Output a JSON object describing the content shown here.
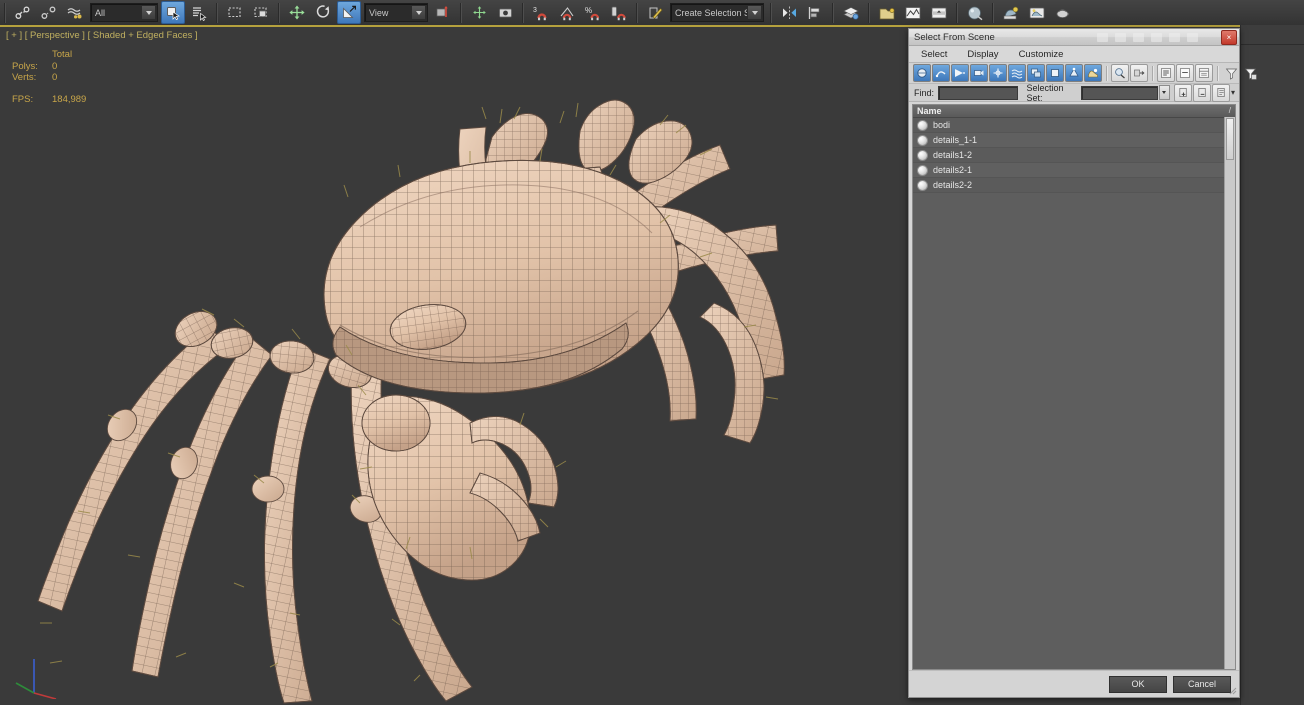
{
  "toolbar": {
    "undo_icon": "undo-icon",
    "redo_icon": "redo-icon",
    "link_icon": "select-and-link-icon",
    "unlink_icon": "unlink-selection-icon",
    "bind_icon": "bind-to-space-warp-icon",
    "selection_filter": "All",
    "select_object_icon": "select-object-icon",
    "select_by_name_icon": "select-by-name-icon",
    "rect_select_icon": "rectangular-selection-region-icon",
    "window_crossing_icon": "window-crossing-icon",
    "move_icon": "select-and-move-icon",
    "rotate_icon": "select-and-rotate-icon",
    "scale_icon": "select-and-uniform-scale-icon",
    "reference_coord_system": "View",
    "pivot_icon": "use-pivot-point-center-icon",
    "snap_icon": "snaps-toggle-icon",
    "snap_label": "3",
    "angle_snap_icon": "angle-snap-toggle-icon",
    "percent_snap_icon": "percent-snap-toggle-icon",
    "percent_label": "%",
    "spinner_snap_icon": "spinner-snap-toggle-icon",
    "edit_named_sets_icon": "edit-named-selection-sets-icon",
    "named_selection_set": "Create Selection Se",
    "mirror_icon": "mirror-icon",
    "align_icon": "align-icon",
    "layer_manager_icon": "layer-manager-icon",
    "curve_editor_icon": "curve-editor-icon",
    "schematic_view_icon": "schematic-view-icon",
    "material_editor_icon": "material-editor-icon",
    "render_setup_icon": "render-setup-icon",
    "rendered_frame_icon": "rendered-frame-window-icon",
    "render_production_icon": "render-production-icon"
  },
  "viewport": {
    "label": "[ + ] [ Perspective ] [ Shaded + Edged Faces ]",
    "stats": {
      "total_header": "Total",
      "polys_label": "Polys:",
      "polys_value": "0",
      "verts_label": "Verts:",
      "verts_value": "0",
      "fps_label": "FPS:",
      "fps_value": "184,989"
    },
    "axis_gizmo": "world-axis-tripod-icon",
    "model": "crab-wireframe-model",
    "background_color": "#3a3a3a",
    "model_color": "#e3c5ab",
    "wire_color": "#5d4a3f"
  },
  "dialog": {
    "title": "Select From Scene",
    "close_label": "×",
    "menu": [
      {
        "label": "Select"
      },
      {
        "label": "Display"
      },
      {
        "label": "Customize"
      }
    ],
    "tools": [
      {
        "name": "display-geometry-icon",
        "state": "on"
      },
      {
        "name": "display-shapes-icon",
        "state": "on"
      },
      {
        "name": "display-lights-icon",
        "state": "on"
      },
      {
        "name": "display-cameras-icon",
        "state": "on"
      },
      {
        "name": "display-helpers-icon",
        "state": "on"
      },
      {
        "name": "display-space-warps-icon",
        "state": "on"
      },
      {
        "name": "display-groups-icon",
        "state": "on"
      },
      {
        "name": "display-xrefs-icon",
        "state": "on"
      },
      {
        "name": "display-bones-icon",
        "state": "on"
      },
      {
        "name": "display-all-icon",
        "state": "on"
      },
      {
        "name": "select-subtree-icon",
        "state": "plain"
      },
      {
        "name": "select-influences-icon",
        "state": "plain"
      },
      {
        "name": "expand-all-icon",
        "state": "plain"
      },
      {
        "name": "collapse-all-icon",
        "state": "plain"
      },
      {
        "name": "list-types-icon",
        "state": "plain"
      },
      {
        "name": "filter-icon",
        "state": "flat"
      },
      {
        "name": "clear-filter-icon",
        "state": "flat"
      }
    ],
    "find": {
      "label": "Find:",
      "value": "",
      "placeholder": ""
    },
    "selection_set": {
      "label": "Selection Set:",
      "value": "",
      "placeholder": ""
    },
    "selset_buttons": [
      {
        "name": "add-selection-set-icon"
      },
      {
        "name": "remove-selection-set-icon"
      },
      {
        "name": "edit-selection-set-icon"
      }
    ],
    "selset_more_icon": "chevron-down-icon",
    "list": {
      "column_header": "Name",
      "sort_indicator": "/",
      "rows": [
        {
          "name": "bodi",
          "icon": "geometry-object-icon"
        },
        {
          "name": "details_1-1",
          "icon": "geometry-object-icon"
        },
        {
          "name": "details1-2",
          "icon": "geometry-object-icon"
        },
        {
          "name": "details2-1",
          "icon": "geometry-object-icon"
        },
        {
          "name": "details2-2",
          "icon": "geometry-object-icon"
        }
      ]
    },
    "footer": {
      "ok_label": "OK",
      "cancel_label": "Cancel"
    }
  }
}
